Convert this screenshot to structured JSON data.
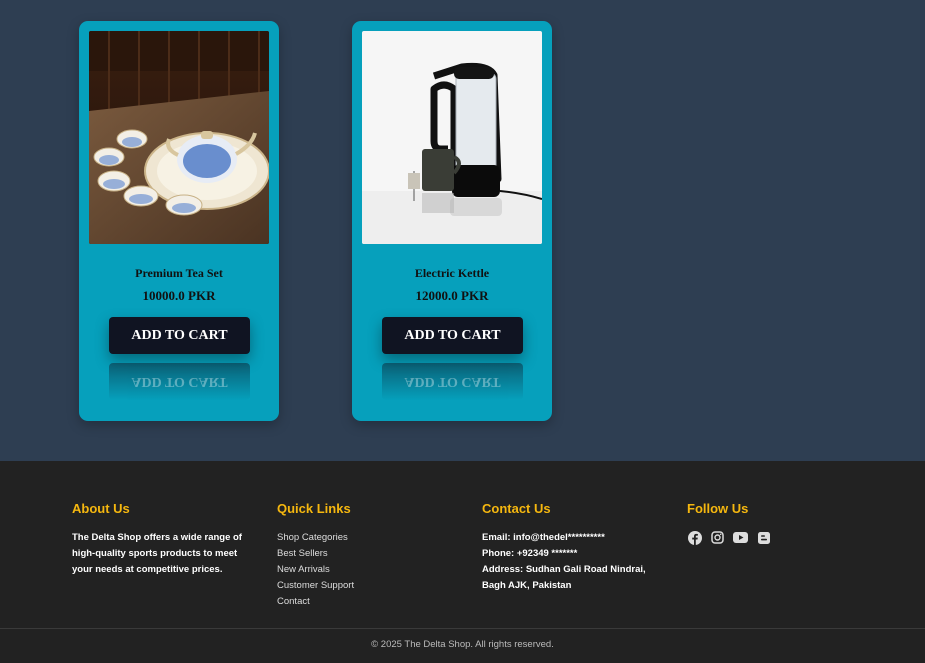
{
  "products": [
    {
      "title": "Premium Tea Set",
      "price": "10000.0 PKR",
      "button_label": "ADD TO CART",
      "image": "tea-set-photo"
    },
    {
      "title": "Electric Kettle",
      "price": "12000.0 PKR",
      "button_label": "ADD TO CART",
      "image": "electric-kettle-photo"
    }
  ],
  "footer": {
    "about": {
      "heading": "About Us",
      "text": "The Delta Shop offers a wide range of high-quality sports products to meet your needs at competitive prices."
    },
    "quick_links": {
      "heading": "Quick Links",
      "items": [
        "Shop Categories",
        "Best Sellers",
        "New Arrivals",
        "Customer Support",
        "Contact"
      ]
    },
    "contact": {
      "heading": "Contact Us",
      "email": "Email: info@thedel**********",
      "phone": "Phone: +92349 *******",
      "address": "Address: Sudhan Gali Road Nindrai, Bagh AJK, Pakistan"
    },
    "follow": {
      "heading": "Follow Us",
      "icons": [
        "facebook-icon",
        "instagram-icon",
        "youtube-icon",
        "blogger-icon"
      ]
    },
    "copyright": "© 2025 The Delta Shop. All rights reserved."
  },
  "colors": {
    "page_bg": "#2e3e52",
    "card_bg": "#06a0bc",
    "button_bg": "#101422",
    "footer_bg": "#222222",
    "footer_heading": "#f5b70f"
  }
}
